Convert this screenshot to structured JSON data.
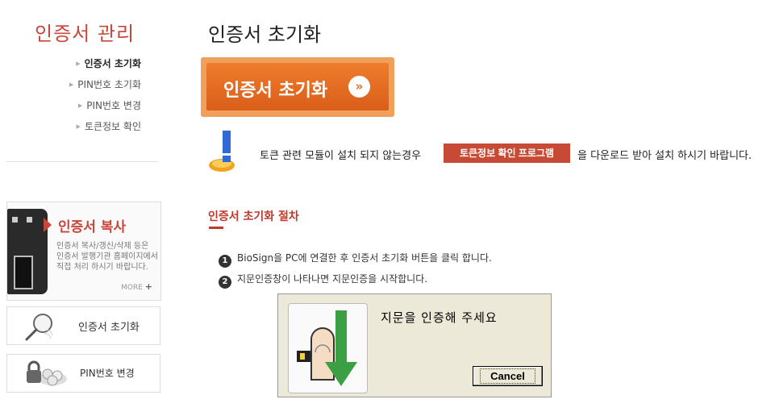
{
  "sidebar": {
    "title": "인증서 관리",
    "menu": [
      {
        "label": "인증서 초기화",
        "active": true
      },
      {
        "label": "PIN번호 초기화",
        "active": false
      },
      {
        "label": "PIN번호 변경",
        "active": false
      },
      {
        "label": "토큰정보 확인",
        "active": false
      }
    ],
    "copy_banner": {
      "title": "인증서 복사",
      "desc_lines": [
        "인증서 복사/갱신/삭제 등은",
        "인증서 발행기관 홈페이지에서",
        "직접 처리 하시기 바랍니다."
      ],
      "more_label": "MORE",
      "more_icon": "+"
    },
    "link_boxes": [
      {
        "label": "인증서 초기화",
        "icon": "magnifier-icon"
      },
      {
        "label": "PIN번호 변경",
        "icon": "lock-coins-icon"
      }
    ]
  },
  "main": {
    "title": "인증서 초기화",
    "init_button": {
      "label": "인증서 초기화",
      "icon": "»"
    },
    "notice": {
      "before": "토큰 관련 모듈이 설치 되지 않는경우",
      "download_button": "토큰정보 확인 프로그램",
      "after": "을 다운로드 받아 설치 하시기 바랍니다.",
      "icon": "warning-icon"
    },
    "section_title": "인증서 초기화 절차",
    "steps": [
      {
        "num": "1",
        "text": "BioSign을 PC에 연결한 후 인증서 초기화 버튼을 클릭 합니다."
      },
      {
        "num": "2",
        "text": "지문인증창이 나타나면 지문인증을 시작합니다."
      }
    ],
    "dialog": {
      "message": "지문을 인증해 주세요",
      "cancel_label": "Cancel"
    }
  },
  "colors": {
    "accent_red": "#c8463a",
    "orange": "#e06a22",
    "download_red": "#c74a34",
    "dialog_bg": "#ece9d8"
  }
}
